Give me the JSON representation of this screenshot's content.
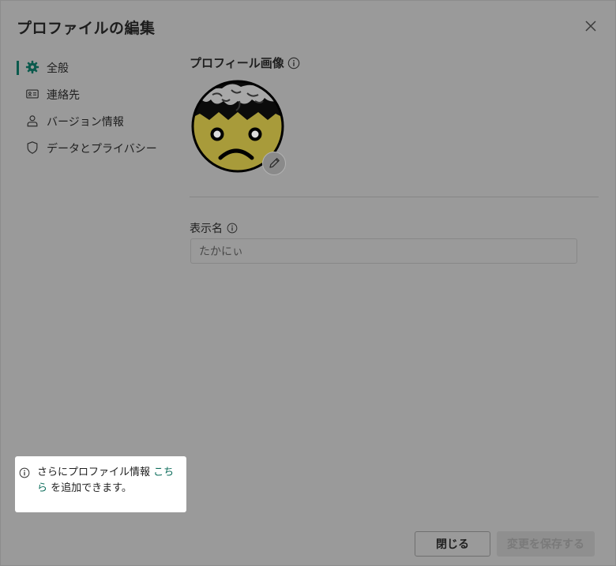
{
  "dialog": {
    "title": "プロファイルの編集",
    "close_icon": "close-icon"
  },
  "sidebar": {
    "items": [
      {
        "label": "全般",
        "icon": "gear-icon",
        "active": true
      },
      {
        "label": "連絡先",
        "icon": "contact-card-icon",
        "active": false
      },
      {
        "label": "バージョン情報",
        "icon": "person-icon",
        "active": false
      },
      {
        "label": "データとプライバシー",
        "icon": "shield-icon",
        "active": false
      }
    ]
  },
  "profile_image": {
    "title": "プロフィール画像",
    "info_icon": "info-icon",
    "edit_icon": "pencil-icon"
  },
  "display_name": {
    "label": "表示名",
    "value": "たかにぃ"
  },
  "tooltip": {
    "text_before": "さらにプロファイル情報 ",
    "link": "こちら",
    "text_after": " を追加できます。"
  },
  "buttons": {
    "close_label": "閉じる",
    "save_label": "変更を保存する"
  },
  "colors": {
    "accent": "#0b5a4d",
    "link": "#0b6c5a",
    "overlay": "#9a9a9a"
  }
}
